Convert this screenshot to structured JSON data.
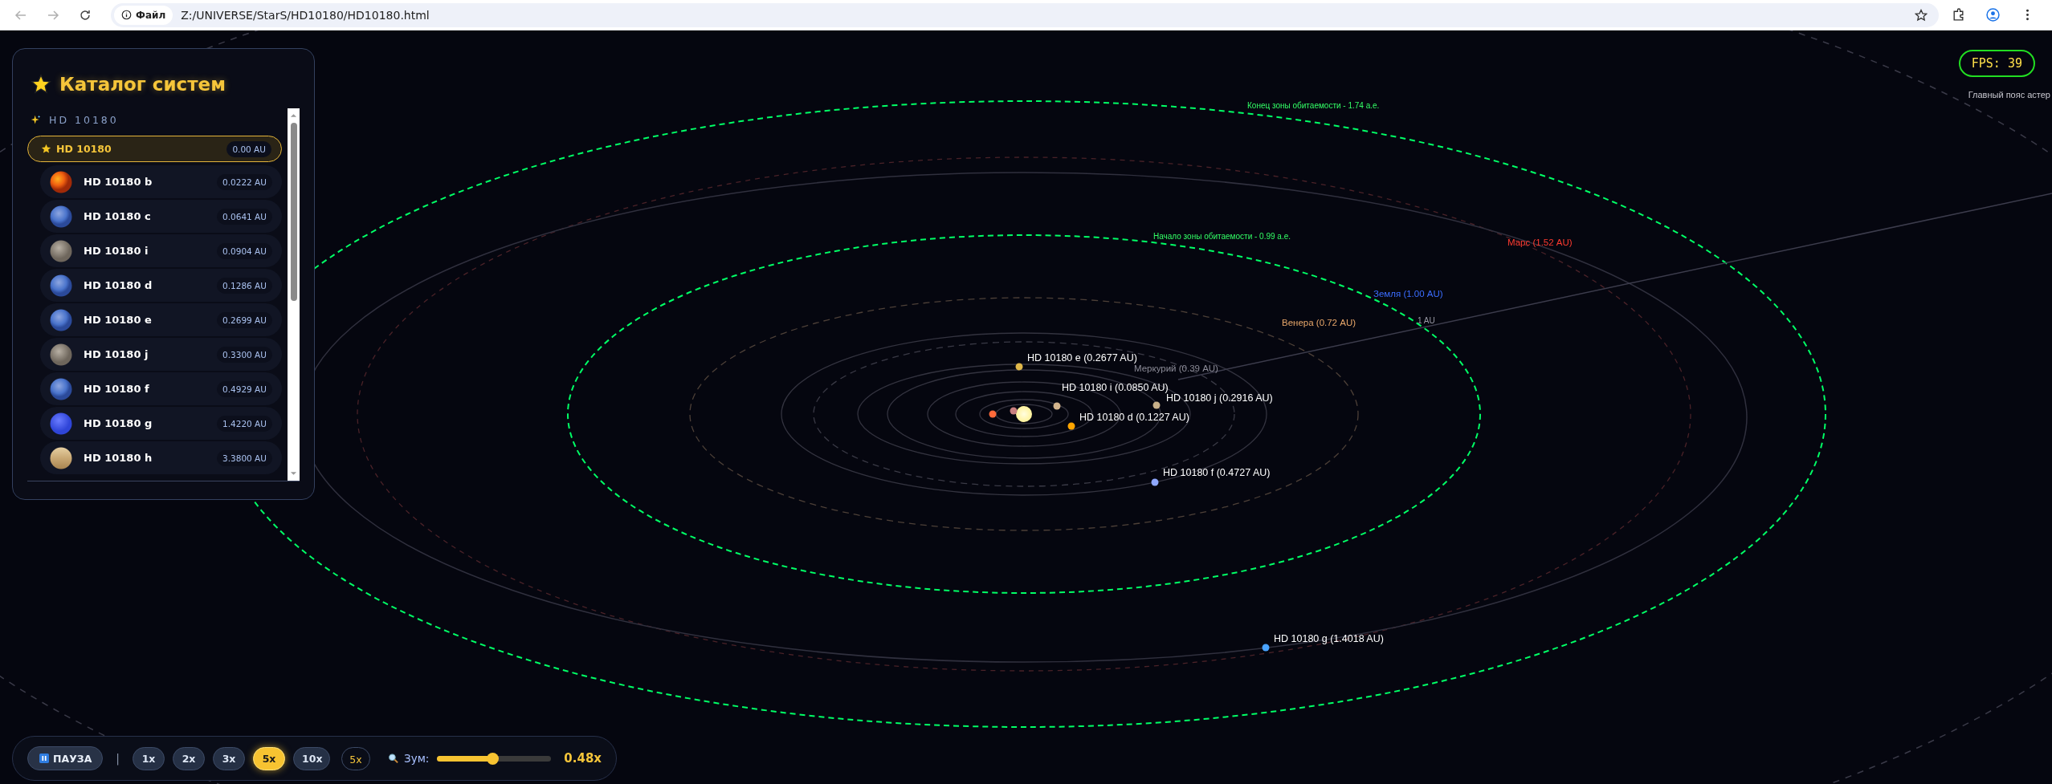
{
  "browser": {
    "scheme_label": "Файл",
    "url": "Z:/UNIVERSE/StarS/HD10180/HD10180.html"
  },
  "catalog": {
    "title": "Каталог систем",
    "system_name": "HD 10180",
    "star": {
      "name": "HD 10180",
      "distance": "0.00 AU",
      "selected": true
    },
    "planets": [
      {
        "name": "HD 10180 b",
        "distance": "0.0222 AU",
        "kind": "lava",
        "selected": false
      },
      {
        "name": "HD 10180 c",
        "distance": "0.0641 AU",
        "kind": "ice",
        "selected": false
      },
      {
        "name": "HD 10180 i",
        "distance": "0.0904 AU",
        "kind": "rocky",
        "selected": false
      },
      {
        "name": "HD 10180 d",
        "distance": "0.1286 AU",
        "kind": "ice",
        "selected": false
      },
      {
        "name": "HD 10180 e",
        "distance": "0.2699 AU",
        "kind": "ice",
        "selected": false
      },
      {
        "name": "HD 10180 j",
        "distance": "0.3300 AU",
        "kind": "rocky",
        "selected": false
      },
      {
        "name": "HD 10180 f",
        "distance": "0.4929 AU",
        "kind": "ice",
        "selected": false
      },
      {
        "name": "HD 10180 g",
        "distance": "1.4220 AU",
        "kind": "ocean",
        "selected": false
      },
      {
        "name": "HD 10180 h",
        "distance": "3.3800 AU",
        "kind": "gas",
        "selected": false
      }
    ]
  },
  "map": {
    "zone_labels": [
      {
        "text": "Конец зоны обитаемости - 1.74 а.е.",
        "color": "#33ff66"
      },
      {
        "text": "Начало зоны обитаемости - 0.99 а.е.",
        "color": "#33ff66"
      },
      {
        "text": "Главный пояс астер",
        "color": "#c8c8d0"
      }
    ],
    "reference_labels": [
      {
        "text": "Марс (1.52 AU)",
        "color": "#ff3b30"
      },
      {
        "text": "Земля (1.00 AU)",
        "color": "#3b6dff"
      },
      {
        "text": "Венера (0.72 AU)",
        "color": "#e8a76a"
      },
      {
        "text": "1 AU",
        "color": "#9a9aa6"
      },
      {
        "text": "Меркурий (0.39 AU)",
        "color": "#8c8c98"
      }
    ],
    "planets": [
      {
        "label": "HD 10180 e (0.2677 AU)",
        "color": "#e0b84a"
      },
      {
        "label": "HD 10180 i (0.0850 AU)",
        "color": "#d2b48c"
      },
      {
        "label": "HD 10180 j (0.2916 AU)",
        "color": "#c8b08a"
      },
      {
        "label": "HD 10180 d (0.1227 AU)",
        "color": "#ffa500"
      },
      {
        "label": "HD 10180 f (0.4727 AU)",
        "color": "#8fa8ff"
      },
      {
        "label": "HD 10180 g (1.4018 AU)",
        "color": "#4aa3ff"
      }
    ]
  },
  "fps": "FPS: 39",
  "controls": {
    "pause": "ПАУЗА",
    "separator": "|",
    "speeds": [
      {
        "label": "1x",
        "selected": false
      },
      {
        "label": "2x",
        "selected": false
      },
      {
        "label": "3x",
        "selected": false
      },
      {
        "label": "5x",
        "selected": true
      },
      {
        "label": "10x",
        "selected": false
      }
    ],
    "current_speed": "5x",
    "zoom_label": "Зум:",
    "zoom": {
      "level": 0.48
    },
    "zoom_reading": "0.48x"
  }
}
